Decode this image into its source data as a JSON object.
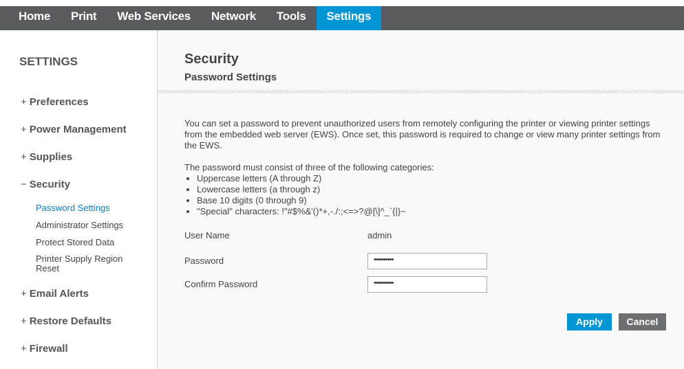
{
  "nav": [
    "Home",
    "Print",
    "Web Services",
    "Network",
    "Tools",
    "Settings"
  ],
  "sidebar": {
    "title": "SETTINGS",
    "items": [
      {
        "sign": "+",
        "label": "Preferences"
      },
      {
        "sign": "+",
        "label": "Power Management"
      },
      {
        "sign": "+",
        "label": "Supplies"
      },
      {
        "sign": "−",
        "label": "Security"
      },
      {
        "sign": "+",
        "label": "Email Alerts"
      },
      {
        "sign": "+",
        "label": "Restore Defaults"
      },
      {
        "sign": "+",
        "label": "Firewall"
      }
    ],
    "subitems": [
      "Password Settings",
      "Administrator Settings",
      "Protect Stored Data",
      "Printer Supply Region Reset"
    ]
  },
  "main": {
    "title": "Security",
    "subtitle": "Password Settings",
    "intro": "You can set a password to prevent unauthorized users from remotely configuring the printer or viewing printer settings from the embedded web server (EWS). Once set, this password is required to change or view many printer settings from the EWS.",
    "rules_intro": "The password must consist of three of the following categories:",
    "rules": [
      "Uppercase letters (A through Z)",
      "Lowercase letters (a through z)",
      "Base 10 digits (0 through 9)",
      "\"Special\" characters: !\"#$%&'()*+,-./:;<=>?@[\\]^_`{|}~"
    ],
    "username_label": "User Name",
    "username": "admin",
    "password_label": "Password",
    "password": "••••••••••",
    "confirm_label": "Confirm Password",
    "confirm": "••••••••••",
    "apply": "Apply",
    "cancel": "Cancel"
  },
  "colors": {
    "accent": "#0096d6",
    "nav": "#595c5c",
    "cancel": "#6d7070"
  }
}
